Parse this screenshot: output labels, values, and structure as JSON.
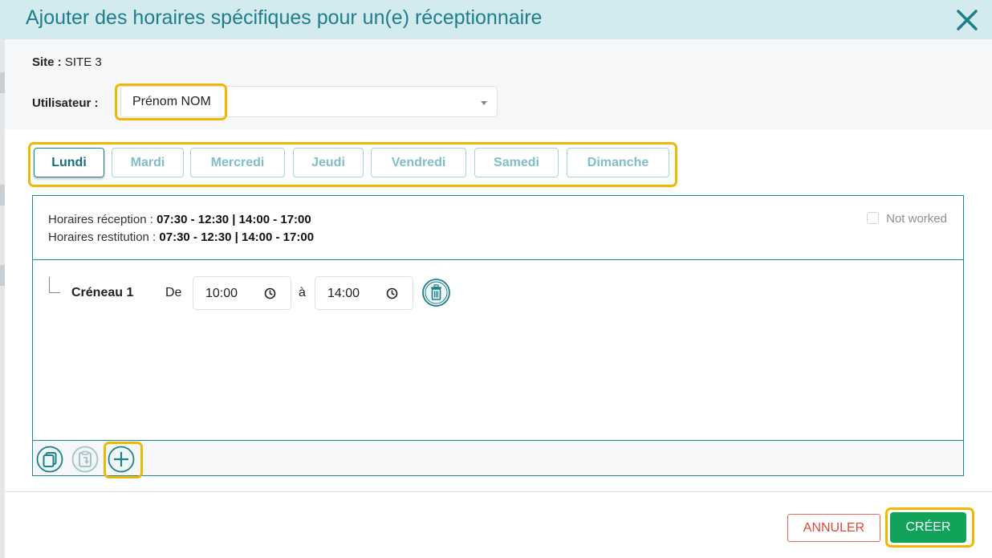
{
  "modal": {
    "title": "Ajouter des horaires spécifiques pour un(e) réceptionnaire"
  },
  "site": {
    "label": "Site :",
    "value": "SITE 3"
  },
  "user": {
    "label": "Utilisateur :",
    "selected": "Prénom NOM"
  },
  "day_tabs": [
    {
      "label": "Lundi",
      "active": true
    },
    {
      "label": "Mardi",
      "active": false
    },
    {
      "label": "Mercredi",
      "active": false
    },
    {
      "label": "Jeudi",
      "active": false
    },
    {
      "label": "Vendredi",
      "active": false
    },
    {
      "label": "Samedi",
      "active": false
    },
    {
      "label": "Dimanche",
      "active": false
    }
  ],
  "schedule_info": {
    "reception_label": "Horaires réception :",
    "reception_hours": "07:30 - 12:30 | 14:00 - 17:00",
    "restitution_label": "Horaires restitution :",
    "restitution_hours": "07:30 - 12:30 | 14:00 - 17:00",
    "not_worked_label": "Not worked",
    "not_worked_checked": false
  },
  "slots": [
    {
      "label": "Créneau 1",
      "from_label": "De",
      "from": "10:00",
      "to_label": "à",
      "to": "14:00"
    }
  ],
  "footer_icons": [
    "copy-icon",
    "paste-icon",
    "add-circle-icon"
  ],
  "actions": {
    "cancel": "ANNULER",
    "create": "CRÉER"
  },
  "colors": {
    "accent": "#1e7f8c",
    "header_bg": "#d3eaee",
    "highlight": "#f2b705",
    "create": "#12a35a",
    "cancel": "#d9483b"
  }
}
